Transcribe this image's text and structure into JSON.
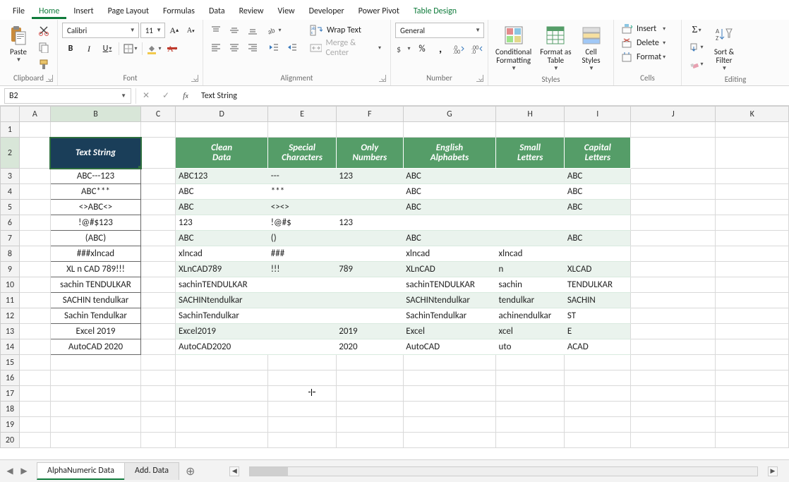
{
  "menu": {
    "items": [
      "File",
      "Home",
      "Insert",
      "Page Layout",
      "Formulas",
      "Data",
      "Review",
      "View",
      "Developer",
      "Power Pivot",
      "Table Design"
    ],
    "active": 1,
    "accent_idx": 10
  },
  "ribbon": {
    "clipboard": {
      "label": "Clipboard",
      "paste": "Paste"
    },
    "font": {
      "label": "Font",
      "name": "Calibri",
      "size": "11"
    },
    "alignment": {
      "label": "Alignment",
      "wrap": "Wrap Text",
      "merge": "Merge & Center"
    },
    "number": {
      "label": "Number",
      "format": "General"
    },
    "styles": {
      "label": "Styles",
      "cond": "Conditional\nFormatting",
      "table": "Format as\nTable",
      "cell": "Cell\nStyles"
    },
    "cells": {
      "label": "Cells",
      "insert": "Insert",
      "delete": "Delete",
      "format": "Format"
    },
    "editing": {
      "label": "Editing",
      "sort": "Sort &\nFilter"
    }
  },
  "formula_bar": {
    "namebox": "B2",
    "content": "Text String"
  },
  "columns": [
    "A",
    "B",
    "C",
    "D",
    "E",
    "F",
    "G",
    "H",
    "I",
    "J",
    "K"
  ],
  "rowlabels": [
    "1",
    "2",
    "3",
    "4",
    "5",
    "6",
    "7",
    "8",
    "9",
    "10",
    "11",
    "12",
    "13",
    "14",
    "15",
    "16",
    "17",
    "18",
    "19",
    "20"
  ],
  "bheader": "Text String",
  "gheaders": [
    "Clean Data",
    "Special Characters",
    "Only Numbers",
    "English Alphabets",
    "Small Letters",
    "Capital Letters"
  ],
  "rows": [
    {
      "b": "ABC---123",
      "d": "ABC123",
      "e": "---",
      "f": "123",
      "g": "ABC",
      "h": "",
      "i": "ABC"
    },
    {
      "b": "ABC***",
      "d": "ABC",
      "e": "***",
      "f": "",
      "g": "ABC",
      "h": "",
      "i": "ABC"
    },
    {
      "b": "<>ABC<>",
      "d": "ABC",
      "e": "<><>",
      "f": "",
      "g": "ABC",
      "h": "",
      "i": "ABC"
    },
    {
      "b": "!@#$123",
      "d": "123",
      "e": "!@#$",
      "f": "123",
      "g": "",
      "h": "",
      "i": ""
    },
    {
      "b": "(ABC)",
      "d": "ABC",
      "e": "()",
      "f": "",
      "g": "ABC",
      "h": "",
      "i": "ABC"
    },
    {
      "b": "###xlncad",
      "d": "xlncad",
      "e": "###",
      "f": "",
      "g": "xlncad",
      "h": "xlncad",
      "i": ""
    },
    {
      "b": "XL n CAD 789!!!",
      "d": "XLnCAD789",
      "e": "!!!",
      "f": "789",
      "g": "XLnCAD",
      "h": "n",
      "i": "XLCAD"
    },
    {
      "b": "sachin TENDULKAR",
      "d": "sachinTENDULKAR",
      "e": "",
      "f": "",
      "g": "sachinTENDULKAR",
      "h": "sachin",
      "i": "TENDULKAR"
    },
    {
      "b": "SACHIN tendulkar",
      "d": "SACHINtendulkar",
      "e": "",
      "f": "",
      "g": "SACHINtendulkar",
      "h": "tendulkar",
      "i": "SACHIN"
    },
    {
      "b": "Sachin Tendulkar",
      "d": "SachinTendulkar",
      "e": "",
      "f": "",
      "g": "SachinTendulkar",
      "h": "achinendulkar",
      "i": "ST"
    },
    {
      "b": "Excel 2019",
      "d": "Excel2019",
      "e": "",
      "f": "2019",
      "g": "Excel",
      "h": "xcel",
      "i": "E"
    },
    {
      "b": "AutoCAD 2020",
      "d": "AutoCAD2020",
      "e": "",
      "f": "2020",
      "g": "AutoCAD",
      "h": "uto",
      "i": "ACAD"
    }
  ],
  "tabs": {
    "items": [
      "AlphaNumeric Data",
      "Add. Data"
    ],
    "active": 0
  }
}
